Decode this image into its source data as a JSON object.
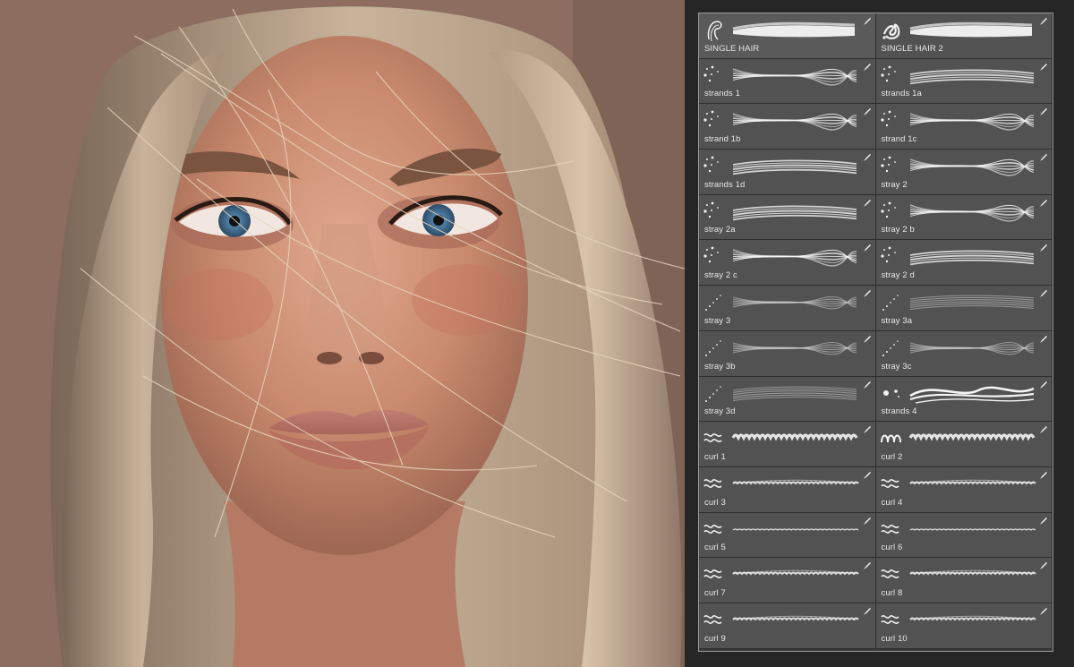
{
  "photo": {
    "subject": "portrait-photo"
  },
  "brush_panel": {
    "brushes": [
      {
        "label": "SINGLE HAIR",
        "tip": "single",
        "stroke": "brush"
      },
      {
        "label": "SINGLE HAIR 2",
        "tip": "scribble",
        "stroke": "brush"
      },
      {
        "label": "strands 1",
        "tip": "dots",
        "stroke": "strands"
      },
      {
        "label": "strands 1a",
        "tip": "dots",
        "stroke": "strands-flat"
      },
      {
        "label": "strand 1b",
        "tip": "dots",
        "stroke": "strands"
      },
      {
        "label": "strand 1c",
        "tip": "dots",
        "stroke": "strands"
      },
      {
        "label": "strands 1d",
        "tip": "dots",
        "stroke": "strands-flat"
      },
      {
        "label": "stray 2",
        "tip": "dots",
        "stroke": "strands"
      },
      {
        "label": "stray 2a",
        "tip": "dots",
        "stroke": "strands-flat"
      },
      {
        "label": "stray 2 b",
        "tip": "dots",
        "stroke": "strands"
      },
      {
        "label": "stray 2 c",
        "tip": "dots",
        "stroke": "strands"
      },
      {
        "label": "stray 2 d",
        "tip": "dots",
        "stroke": "strands-flat"
      },
      {
        "label": "stray 3",
        "tip": "diag",
        "stroke": "soft"
      },
      {
        "label": "stray 3a",
        "tip": "diag",
        "stroke": "soft-flat"
      },
      {
        "label": "stray 3b",
        "tip": "diag",
        "stroke": "soft"
      },
      {
        "label": "stray 3c",
        "tip": "diag",
        "stroke": "soft"
      },
      {
        "label": "stray 3d",
        "tip": "diag",
        "stroke": "soft-flat"
      },
      {
        "label": "strands 4",
        "tip": "bigdots",
        "stroke": "bold"
      },
      {
        "label": "curl 1",
        "tip": "zig",
        "stroke": "curl-thick"
      },
      {
        "label": "curl 2",
        "tip": "loops",
        "stroke": "curl-thick"
      },
      {
        "label": "curl 3",
        "tip": "zig",
        "stroke": "curl"
      },
      {
        "label": "curl 4",
        "tip": "zig",
        "stroke": "curl"
      },
      {
        "label": "curl 5",
        "tip": "zig",
        "stroke": "curl-thin"
      },
      {
        "label": "curl 6",
        "tip": "zig",
        "stroke": "curl-thin"
      },
      {
        "label": "curl 7",
        "tip": "zig",
        "stroke": "curl"
      },
      {
        "label": "curl 8",
        "tip": "zig",
        "stroke": "curl"
      },
      {
        "label": "curl 9",
        "tip": "zig",
        "stroke": "curl"
      },
      {
        "label": "curl 10",
        "tip": "zig",
        "stroke": "curl"
      }
    ]
  }
}
